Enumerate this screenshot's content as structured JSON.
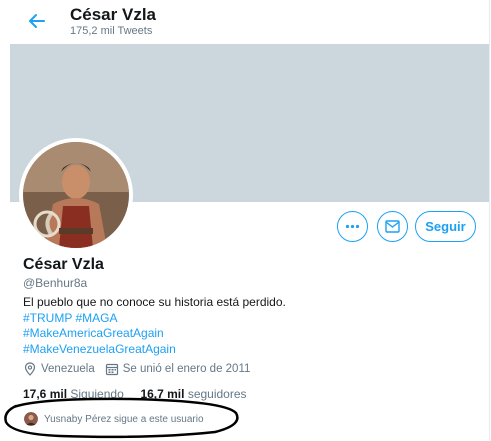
{
  "header": {
    "title": "César Vzla",
    "subtitle": "175,2 mil Tweets"
  },
  "profile": {
    "name": "César Vzla",
    "handle": "@Benhur8a",
    "bio_text": "El pueblo que no conoce su historia está perdido.",
    "hashtags": [
      "#TRUMP",
      "#MAGA",
      "#MakeAmericaGreatAgain",
      "#MakeVenezuelaGreatAgain"
    ],
    "location": "Venezuela",
    "joined": "Se unió el enero de 2011",
    "following_count": "17,6 mil",
    "following_label": "Siguiendo",
    "followers_count": "16,7 mil",
    "followers_label": "seguidores",
    "followed_by_text": "Yusnaby Pérez sigue a este usuario"
  },
  "actions": {
    "follow_label": "Seguir"
  },
  "icons": {
    "back": "arrow-left-icon",
    "more": "more-horizontal-icon",
    "message": "mail-icon",
    "location": "location-pin-icon",
    "calendar": "calendar-icon"
  },
  "colors": {
    "accent": "#1da1f2",
    "banner": "#ccd6dd",
    "muted": "#657786"
  }
}
